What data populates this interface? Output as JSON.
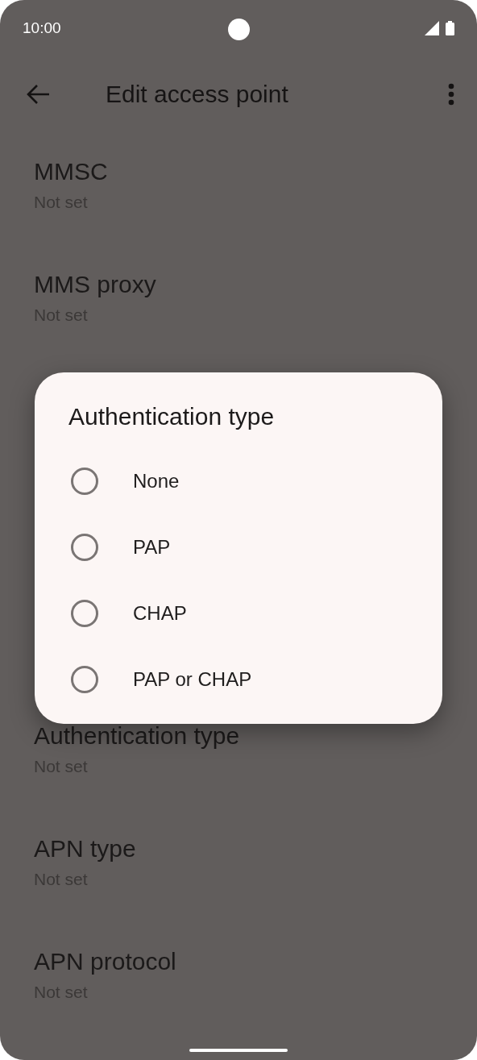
{
  "status_bar": {
    "time": "10:00"
  },
  "app_bar": {
    "title": "Edit access point"
  },
  "settings_top": [
    {
      "title": "MMSC",
      "summary": "Not set"
    },
    {
      "title": "MMS proxy",
      "summary": "Not set"
    }
  ],
  "settings_bottom": [
    {
      "title": "Authentication type",
      "summary": "Not set"
    },
    {
      "title": "APN type",
      "summary": "Not set"
    },
    {
      "title": "APN protocol",
      "summary": "Not set"
    }
  ],
  "dialog": {
    "title": "Authentication type",
    "options": [
      {
        "label": "None",
        "selected": false
      },
      {
        "label": "PAP",
        "selected": false
      },
      {
        "label": "CHAP",
        "selected": false
      },
      {
        "label": "PAP or CHAP",
        "selected": false
      }
    ]
  }
}
